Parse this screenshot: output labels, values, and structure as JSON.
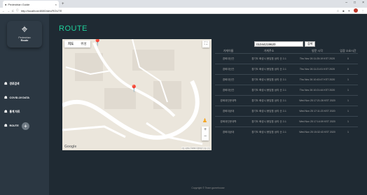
{
  "browser": {
    "tab_title": "Pedestrian Guide",
    "url": "http://localhost:8080/dev/ROUTE",
    "new_tab": "+",
    "minimize": "–",
    "maximize": "□",
    "close": "×"
  },
  "sidebar": {
    "logo_line1": "Pedestrian",
    "logo_line2": "Route",
    "items": [
      {
        "label": "경로검색",
        "icon": "map-icon"
      },
      {
        "label": "COVID-19 DATA",
        "icon": "covid-icon"
      },
      {
        "label": "통계 차트",
        "icon": "chart-icon"
      },
      {
        "label": "ROUTE",
        "icon": "route-icon"
      }
    ],
    "add_button": "+"
  },
  "page": {
    "title": "ROUTE"
  },
  "map": {
    "tab_map": "지도",
    "tab_satellite": "위성",
    "zoom_in": "+",
    "zoom_out": "−",
    "google_logo": "Google",
    "attribution": "지도 데이터 ©2020  이용약관  오류 신고"
  },
  "search": {
    "value": "01044219620",
    "button": "검색"
  },
  "table": {
    "headers": [
      "가게이름",
      "가게주소",
      "방문 시각",
      "입장 소요시간"
    ],
    "rows": [
      {
        "name": "경희대신관",
        "address": "경기도 화성시 봉담읍 상리 산 2-1",
        "time": "Thu Nov 26 11:25:19 KST 2020",
        "duration": "0"
      },
      {
        "name": "경희대신관",
        "address": "경기도 화성시 봉담읍 상리 산 2-1",
        "time": "Thu Nov 26 11:21:01 KST 2020",
        "duration": "0"
      },
      {
        "name": "경희대신관",
        "address": "경기도 화성시 봉담읍 상리 산 2-1",
        "time": "Thu Nov 26 10:43:47 KST 2020",
        "duration": "1"
      },
      {
        "name": "경희대신관",
        "address": "경기도 화성시 봉담읍 상리 산 2-1",
        "time": "Thu Nov 26 10:21:44 KST 2020",
        "duration": "1"
      },
      {
        "name": "경희대인문대학",
        "address": "경기도 화성시 봉담읍 상리 산 2-1",
        "time": "Wed Nov 25 17:21:28 KST 2020",
        "duration": "1"
      },
      {
        "name": "경희대공대",
        "address": "경기도 화성시 봉담읍 상리 산 2-1",
        "time": "Wed Nov 25 17:11:23 KST 2020",
        "duration": "1"
      },
      {
        "name": "경희대인문대학",
        "address": "경기도 화성시 봉담읍 상리 산 2-1",
        "time": "Wed Nov 25 17:14:09 KST 2020",
        "duration": "1"
      },
      {
        "name": "경희대공대",
        "address": "경기도 화성시 봉담읍 상리 산 2-1",
        "time": "Wed Nov 25 15:32:43 KST 2020",
        "duration": "1"
      }
    ]
  },
  "footer": {
    "text": "Copyright © Team gumehouse"
  }
}
